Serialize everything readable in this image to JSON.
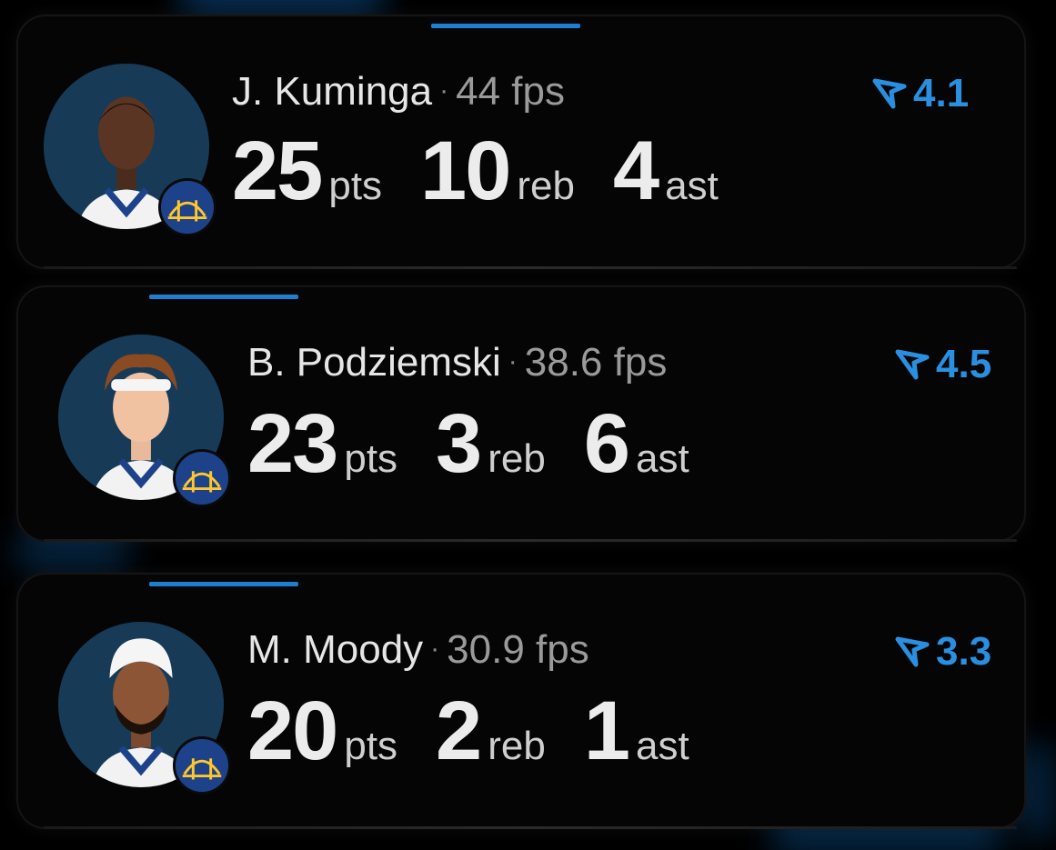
{
  "players": [
    {
      "name": "J. Kuminga",
      "separator": "·",
      "fps": "44 fps",
      "rating": "4.1",
      "stats": [
        {
          "value": "25",
          "unit": "pts"
        },
        {
          "value": "10",
          "unit": "reb"
        },
        {
          "value": "4",
          "unit": "ast"
        }
      ]
    },
    {
      "name": "B. Podziemski",
      "separator": "·",
      "fps": "38.6 fps",
      "rating": "4.5",
      "stats": [
        {
          "value": "23",
          "unit": "pts"
        },
        {
          "value": "3",
          "unit": "reb"
        },
        {
          "value": "6",
          "unit": "ast"
        }
      ]
    },
    {
      "name": "M. Moody",
      "separator": "·",
      "fps": "30.9 fps",
      "rating": "3.3",
      "stats": [
        {
          "value": "20",
          "unit": "pts"
        },
        {
          "value": "2",
          "unit": "reb"
        },
        {
          "value": "1",
          "unit": "ast"
        }
      ]
    }
  ],
  "colors": {
    "accent": "#2a8fe0",
    "team_blue": "#1d428a",
    "team_gold": "#ffc72c"
  },
  "icons": {
    "rating_icon": "rating-triangle-icon",
    "team_logo": "team-logo-icon"
  }
}
